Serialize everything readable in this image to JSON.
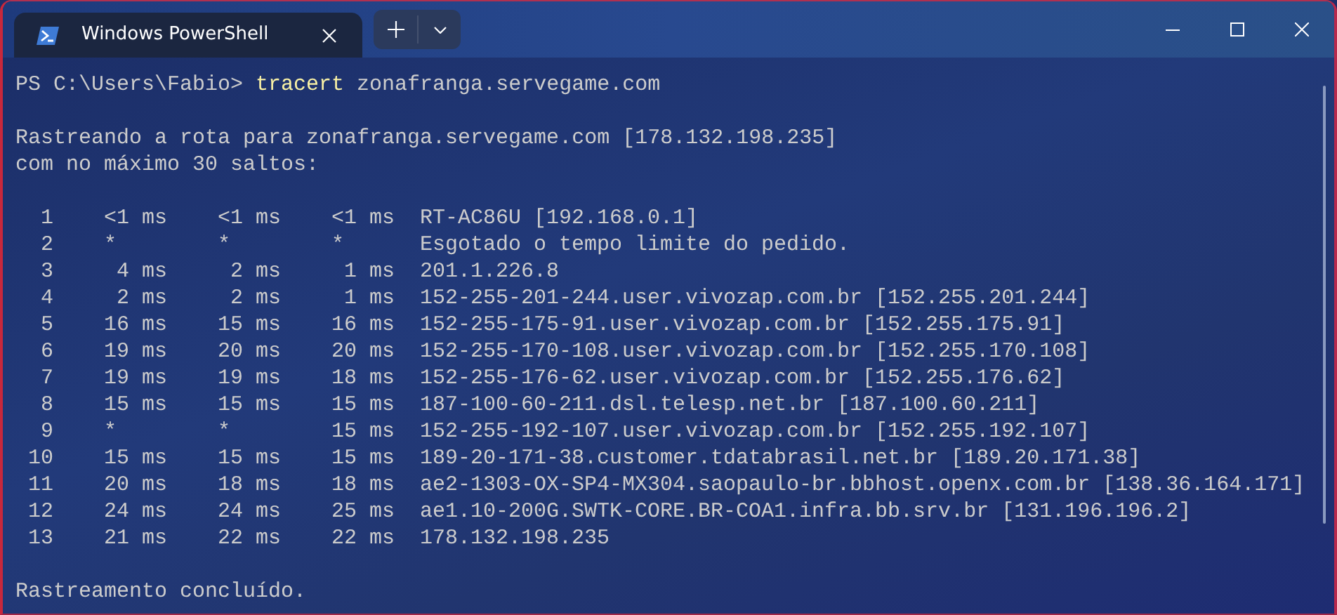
{
  "window": {
    "tab": {
      "title": "Windows PowerShell",
      "selected": true
    }
  },
  "terminal": {
    "prompt": "PS C:\\Users\\Fabio>",
    "command": "tracert",
    "argument": "zonafranga.servegame.com",
    "header": [
      "Rastreando a rota para zonafranga.servegame.com [178.132.198.235]",
      "com no máximo 30 saltos:"
    ],
    "hops": [
      {
        "hop": "1",
        "times": [
          {
            "kind": "time",
            "text": "<1 ms"
          },
          {
            "kind": "time",
            "text": "<1 ms"
          },
          {
            "kind": "time",
            "text": "<1 ms"
          }
        ],
        "host": "RT-AC86U [192.168.0.1]"
      },
      {
        "hop": "2",
        "times": [
          {
            "kind": "timeout",
            "text": "*"
          },
          {
            "kind": "timeout",
            "text": "*"
          },
          {
            "kind": "timeout",
            "text": "*"
          }
        ],
        "host": "Esgotado o tempo limite do pedido."
      },
      {
        "hop": "3",
        "times": [
          {
            "kind": "time",
            "text": "4 ms"
          },
          {
            "kind": "time",
            "text": "2 ms"
          },
          {
            "kind": "time",
            "text": "1 ms"
          }
        ],
        "host": "201.1.226.8"
      },
      {
        "hop": "4",
        "times": [
          {
            "kind": "time",
            "text": "2 ms"
          },
          {
            "kind": "time",
            "text": "2 ms"
          },
          {
            "kind": "time",
            "text": "1 ms"
          }
        ],
        "host": "152-255-201-244.user.vivozap.com.br [152.255.201.244]"
      },
      {
        "hop": "5",
        "times": [
          {
            "kind": "time",
            "text": "16 ms"
          },
          {
            "kind": "time",
            "text": "15 ms"
          },
          {
            "kind": "time",
            "text": "16 ms"
          }
        ],
        "host": "152-255-175-91.user.vivozap.com.br [152.255.175.91]"
      },
      {
        "hop": "6",
        "times": [
          {
            "kind": "time",
            "text": "19 ms"
          },
          {
            "kind": "time",
            "text": "20 ms"
          },
          {
            "kind": "time",
            "text": "20 ms"
          }
        ],
        "host": "152-255-170-108.user.vivozap.com.br [152.255.170.108]"
      },
      {
        "hop": "7",
        "times": [
          {
            "kind": "time",
            "text": "19 ms"
          },
          {
            "kind": "time",
            "text": "19 ms"
          },
          {
            "kind": "time",
            "text": "18 ms"
          }
        ],
        "host": "152-255-176-62.user.vivozap.com.br [152.255.176.62]"
      },
      {
        "hop": "8",
        "times": [
          {
            "kind": "time",
            "text": "15 ms"
          },
          {
            "kind": "time",
            "text": "15 ms"
          },
          {
            "kind": "time",
            "text": "15 ms"
          }
        ],
        "host": "187-100-60-211.dsl.telesp.net.br [187.100.60.211]"
      },
      {
        "hop": "9",
        "times": [
          {
            "kind": "timeout",
            "text": "*"
          },
          {
            "kind": "timeout",
            "text": "*"
          },
          {
            "kind": "time",
            "text": "15 ms"
          }
        ],
        "host": "152-255-192-107.user.vivozap.com.br [152.255.192.107]"
      },
      {
        "hop": "10",
        "times": [
          {
            "kind": "time",
            "text": "15 ms"
          },
          {
            "kind": "time",
            "text": "15 ms"
          },
          {
            "kind": "time",
            "text": "15 ms"
          }
        ],
        "host": "189-20-171-38.customer.tdatabrasil.net.br [189.20.171.38]"
      },
      {
        "hop": "11",
        "times": [
          {
            "kind": "time",
            "text": "20 ms"
          },
          {
            "kind": "time",
            "text": "18 ms"
          },
          {
            "kind": "time",
            "text": "18 ms"
          }
        ],
        "host": "ae2-1303-OX-SP4-MX304.saopaulo-br.bbhost.openx.com.br [138.36.164.171]"
      },
      {
        "hop": "12",
        "times": [
          {
            "kind": "time",
            "text": "24 ms"
          },
          {
            "kind": "time",
            "text": "24 ms"
          },
          {
            "kind": "time",
            "text": "25 ms"
          }
        ],
        "host": "ae1.10-200G.SWTK-CORE.BR-COA1.infra.bb.srv.br [131.196.196.2]"
      },
      {
        "hop": "13",
        "times": [
          {
            "kind": "time",
            "text": "21 ms"
          },
          {
            "kind": "time",
            "text": "22 ms"
          },
          {
            "kind": "time",
            "text": "22 ms"
          }
        ],
        "host": "178.132.198.235"
      }
    ],
    "footer": "Rastreamento concluído."
  }
}
